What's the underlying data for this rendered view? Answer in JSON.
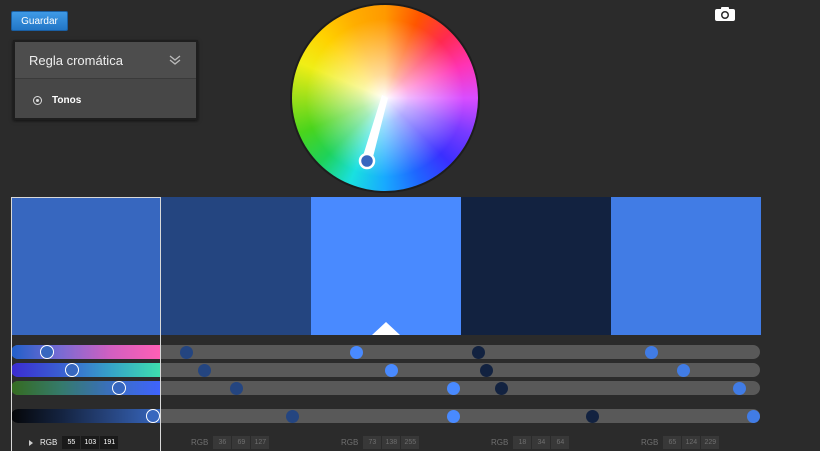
{
  "toolbar": {
    "save_label": "Guardar"
  },
  "rule_panel": {
    "title": "Regla cromática",
    "selected_rule": "Tonos"
  },
  "icons": {
    "camera": "camera-icon",
    "chevron": "double-chevron-down-icon"
  },
  "swatches": [
    {
      "color": "#3767bf",
      "rgb": [
        "55",
        "103",
        "191"
      ]
    },
    {
      "color": "#244580",
      "rgb": [
        "36",
        "69",
        "127"
      ]
    },
    {
      "color": "#498aff",
      "rgb": [
        "73",
        "138",
        "255"
      ]
    },
    {
      "color": "#122240",
      "rgb": [
        "18",
        "34",
        "64"
      ]
    },
    {
      "color": "#417ce5",
      "rgb": [
        "65",
        "124",
        "229"
      ]
    }
  ],
  "rgb_label": "RGB"
}
